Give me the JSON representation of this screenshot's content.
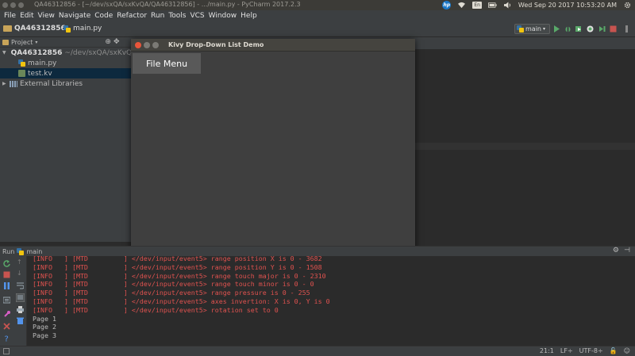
{
  "os_bar": {
    "window_title": "QA46312856 - [~/dev/sxQA/sxKvQA/QA46312856] - .../main.py - PyCharm 2017.2.3",
    "keyboard_layout": "En",
    "clock": "Wed Sep 20 2017 10:53:20 AM"
  },
  "menu": [
    "File",
    "Edit",
    "View",
    "Navigate",
    "Code",
    "Refactor",
    "Run",
    "Tools",
    "VCS",
    "Window",
    "Help"
  ],
  "nav": {
    "project_crumb": "QA46312856",
    "file_crumb": "main.py",
    "run_config": "main"
  },
  "project_panel": {
    "header": "Project",
    "root_name": "QA46312856",
    "root_path": "~/dev/sxQA/sxKvQA",
    "files": [
      "main.py",
      "test.kv"
    ],
    "external": "External Libraries"
  },
  "kivy_window": {
    "title": "Kivy Drop-Down List Demo",
    "button_label": "File Menu"
  },
  "run_panel": {
    "label": "Run",
    "config": "main",
    "console_lines": [
      {
        "text": "[INFO   ] [MTD         ] </dev/input/event5> range position X is 0 - 3682",
        "kind": "err"
      },
      {
        "text": "[INFO   ] [MTD         ] </dev/input/event5> range position Y is 0 - 1508",
        "kind": "err"
      },
      {
        "text": "[INFO   ] [MTD         ] </dev/input/event5> range touch major is 0 - 2310",
        "kind": "err"
      },
      {
        "text": "[INFO   ] [MTD         ] </dev/input/event5> range touch minor is 0 - 0",
        "kind": "err"
      },
      {
        "text": "[INFO   ] [MTD         ] </dev/input/event5> range pressure is 0 - 255",
        "kind": "err"
      },
      {
        "text": "[INFO   ] [MTD         ] </dev/input/event5> axes invertion: X is 0, Y is 0",
        "kind": "err"
      },
      {
        "text": "[INFO   ] [MTD         ] </dev/input/event5> rotation set to 0",
        "kind": "err"
      },
      {
        "text": "Page 1",
        "kind": "out"
      },
      {
        "text": "Page 2",
        "kind": "out"
      },
      {
        "text": "Page 3",
        "kind": "out"
      }
    ]
  },
  "status": {
    "position": "21:1",
    "line_sep": "LF÷",
    "encoding": "UTF-8÷"
  },
  "colors": {
    "error_text": "#e0524f",
    "selection": "#0d293e",
    "close_button": "#e8553a",
    "run_green": "#59a869"
  }
}
